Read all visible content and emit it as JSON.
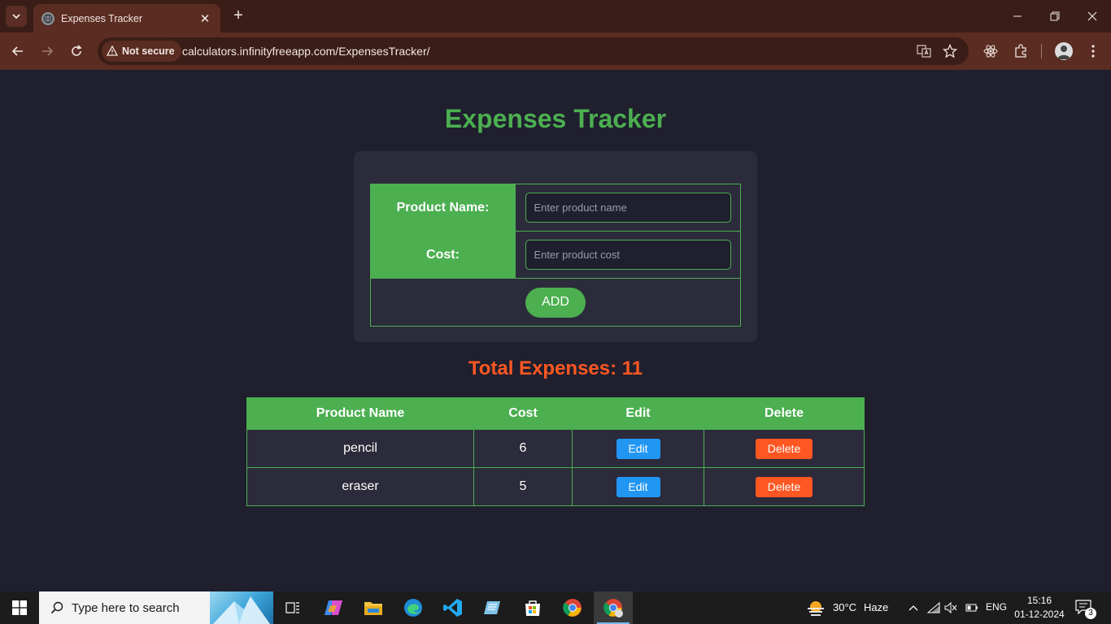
{
  "browser": {
    "tab_title": "Expenses Tracker",
    "new_tab": "+",
    "security_label": "Not secure",
    "url": "calculators.infinityfreeapp.com/ExpensesTracker/"
  },
  "page": {
    "title": "Expenses Tracker",
    "form": {
      "product_label": "Product Name:",
      "product_placeholder": "Enter product name",
      "cost_label": "Cost:",
      "cost_placeholder": "Enter product cost",
      "add_label": "ADD"
    },
    "total": "Total Expenses: 11",
    "table": {
      "headers": [
        "Product Name",
        "Cost",
        "Edit",
        "Delete"
      ],
      "rows": [
        {
          "name": "pencil",
          "cost": "6",
          "edit": "Edit",
          "delete": "Delete"
        },
        {
          "name": "eraser",
          "cost": "5",
          "edit": "Edit",
          "delete": "Delete"
        }
      ]
    }
  },
  "taskbar": {
    "search_placeholder": "Type here to search",
    "weather_temp": "30°C",
    "weather_desc": "Haze",
    "language": "ENG",
    "time": "15:16",
    "date": "01-12-2024",
    "notification_count": "3"
  },
  "colors": {
    "accent_green": "#4caf50",
    "total_orange": "#ff5722",
    "edit_blue": "#2196f3",
    "page_bg": "#1f1f2e",
    "card_bg": "#2b2b3b",
    "chrome_frame": "#3b1d17",
    "chrome_toolbar": "#5a2c22"
  }
}
